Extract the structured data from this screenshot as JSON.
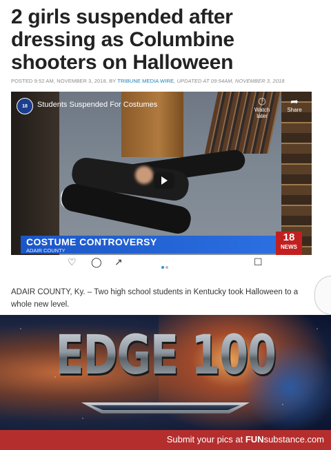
{
  "article": {
    "headline": "2 girls suspended after dressing as Columbine shooters on Halloween",
    "byline_prefix": "POSTED 9:52 AM, NOVEMBER 3, 2018, BY ",
    "byline_author": "TRIBUNE MEDIA WIRE",
    "byline_updated": ", UPDATED AT 09:54AM, NOVEMBER 3, 2018",
    "lede": "ADAIR COUNTY, Ky. – Two high school students in Kentucky took Halloween to a whole new level."
  },
  "video": {
    "channel_badge": "18",
    "title": "Students Suspended For Costumes",
    "watch_later_label": "Watch later",
    "share_label": "Share",
    "lower_third_caption": "COSTUME CONTROVERSY",
    "lower_third_sub": "ADAIR COUNTY",
    "station_number": "18",
    "station_label": "NEWS",
    "carousel_dots": 2,
    "carousel_active_index": 0
  },
  "meme": {
    "title": "EDGE 100"
  },
  "footer": {
    "submit_text": "Submit your pics at ",
    "brand_fun": "FUN",
    "brand_sub": "substance",
    "brand_com": ".com"
  },
  "colors": {
    "headline": "#222222",
    "byline_link": "#1d7fb5",
    "lower_third": "#1b56c8",
    "station": "#c22020",
    "footer": "#b52e2e"
  },
  "icons": {
    "watch_later": "clock-icon",
    "share": "share-arrow-icon",
    "play": "play-icon",
    "like": "heart-icon",
    "comment": "comment-icon",
    "send": "send-icon",
    "save": "bookmark-icon"
  }
}
